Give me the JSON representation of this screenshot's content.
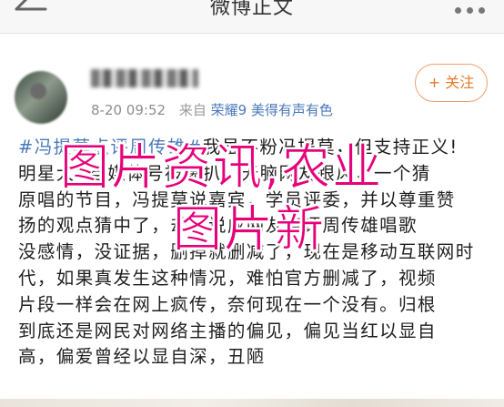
{
  "header": {
    "title": "微博正文",
    "back_icon": "back-arrow-icon",
    "more_icon": "more-dots-icon"
  },
  "post": {
    "time": "8-20 09:52",
    "via": "来自",
    "device": "荣耀9 美得有声有色",
    "follow_label": "+ 关注",
    "topic": "#冯提莫点评周传雄#",
    "lines": [
      "我虽不粉冯提莫，但支持正义!",
      "明星大V自媒体号被爆扒，无脑网友跟风，一个猜",
      "原唱的节目，冯提莫说嘉宾，学员评委，并以尊重赞",
      "扬的观点猜中了，却被说成网友点评周传雄唱歌",
      "没感情，没证据，删掉就删减了，现在是移动互联网时",
      "代，如果真发生这种情况，难怕官方删减了，视频",
      "片段一样会在网上疯传，奈何现在一个没有。归根",
      "到底还是网民对网络主播的偏见，偏见当红以显自",
      "高，偏爱曾经以显自深，丑陋"
    ]
  },
  "watermark": {
    "line1": "图片资讯,农业",
    "line2": "图片新"
  },
  "colors": {
    "link": "#4a79b8",
    "follow": "#e8782c",
    "watermark": "#e6007a"
  }
}
